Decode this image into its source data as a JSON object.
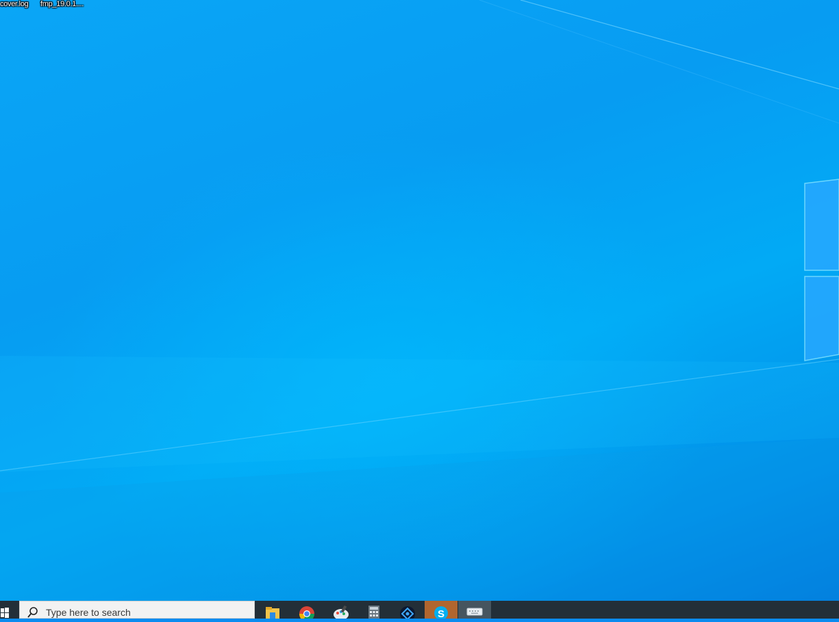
{
  "desktop": {
    "icons": [
      {
        "label": "cover.log"
      },
      {
        "label": "fmp_19.0.1...."
      }
    ]
  },
  "taskbar": {
    "search": {
      "placeholder": "Type here to search"
    },
    "apps": [
      {
        "name": "file-explorer-icon"
      },
      {
        "name": "chrome-icon"
      },
      {
        "name": "paint-icon"
      },
      {
        "name": "calculator-icon"
      },
      {
        "name": "app-icon"
      },
      {
        "name": "skype-icon"
      },
      {
        "name": "keyboard-icon"
      }
    ]
  },
  "colors": {
    "taskbar": "#232f38",
    "desktop_blue": "#0a8cf0",
    "active_app": "#b1662f"
  }
}
